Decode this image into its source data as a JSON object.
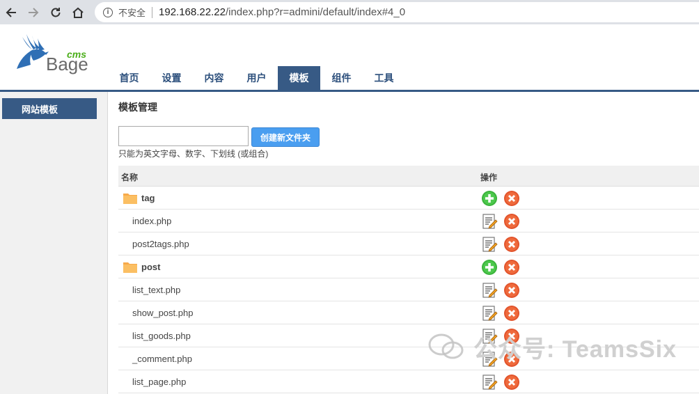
{
  "browser": {
    "insecure_label": "不安全",
    "url_host": "192.168.22.22",
    "url_rest": "/index.php?r=admini/default/index#4_0"
  },
  "logo": {
    "cms": "cms",
    "name": "Bage"
  },
  "topnav": [
    {
      "label": "首页"
    },
    {
      "label": "设置"
    },
    {
      "label": "内容"
    },
    {
      "label": "用户"
    },
    {
      "label": "模板",
      "active": true
    },
    {
      "label": "组件"
    },
    {
      "label": "工具"
    }
  ],
  "sidebar": {
    "item": "网站模板"
  },
  "main": {
    "title": "模板管理",
    "folder_input_value": "",
    "create_button": "创建新文件夹",
    "hint": "只能为英文字母、数字、下划线 (或组合)",
    "col_name": "名称",
    "col_op": "操作",
    "rows": [
      {
        "type": "folder",
        "name": "tag"
      },
      {
        "type": "file",
        "name": "index.php"
      },
      {
        "type": "file",
        "name": "post2tags.php"
      },
      {
        "type": "folder",
        "name": "post"
      },
      {
        "type": "file",
        "name": "list_text.php"
      },
      {
        "type": "file",
        "name": "show_post.php"
      },
      {
        "type": "file",
        "name": "list_goods.php"
      },
      {
        "type": "file",
        "name": "_comment.php"
      },
      {
        "type": "file",
        "name": "list_page.php"
      }
    ]
  },
  "watermark": "公众号: TeamsSix"
}
